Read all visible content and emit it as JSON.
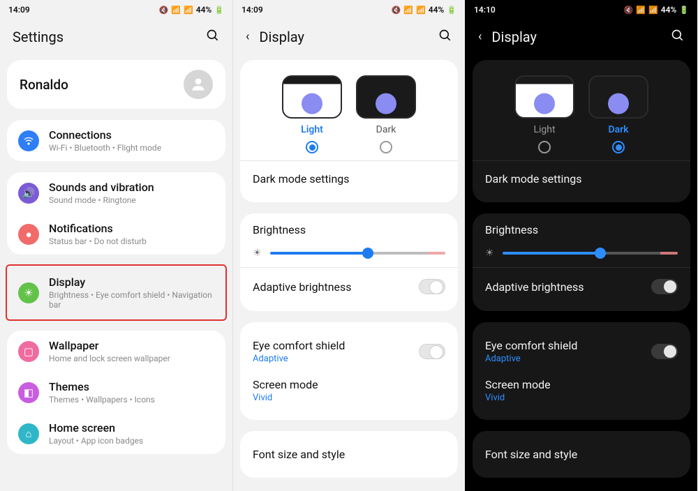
{
  "phone1": {
    "status": {
      "time": "14:09",
      "battery": "44%"
    },
    "header": {
      "title": "Settings"
    },
    "profile": {
      "name": "Ronaldo"
    },
    "items": [
      {
        "title": "Connections",
        "sub": "Wi-Fi  •  Bluetooth  •  Flight mode"
      },
      {
        "title": "Sounds and vibration",
        "sub": "Sound mode  •  Ringtone"
      },
      {
        "title": "Notifications",
        "sub": "Status bar  •  Do not disturb"
      },
      {
        "title": "Display",
        "sub": "Brightness  •  Eye comfort shield  •  Navigation bar"
      },
      {
        "title": "Wallpaper",
        "sub": "Home and lock screen wallpaper"
      },
      {
        "title": "Themes",
        "sub": "Themes  •  Wallpapers  •  Icons"
      },
      {
        "title": "Home screen",
        "sub": "Layout  •  App icon badges"
      }
    ]
  },
  "phone2": {
    "status": {
      "time": "14:09",
      "battery": "44%"
    },
    "header": {
      "title": "Display"
    },
    "theme": {
      "light": "Light",
      "dark": "Dark"
    },
    "rows": {
      "dark_mode_settings": "Dark mode settings",
      "brightness": "Brightness",
      "adaptive": "Adaptive brightness",
      "eye_comfort": "Eye comfort shield",
      "eye_comfort_val": "Adaptive",
      "screen_mode": "Screen mode",
      "screen_mode_val": "Vivid",
      "font": "Font size and style"
    }
  },
  "phone3": {
    "status": {
      "time": "14:10",
      "battery": "44%"
    },
    "header": {
      "title": "Display"
    },
    "theme": {
      "light": "Light",
      "dark": "Dark"
    },
    "rows": {
      "dark_mode_settings": "Dark mode settings",
      "brightness": "Brightness",
      "adaptive": "Adaptive brightness",
      "eye_comfort": "Eye comfort shield",
      "eye_comfort_val": "Adaptive",
      "screen_mode": "Screen mode",
      "screen_mode_val": "Vivid",
      "font": "Font size and style"
    }
  }
}
